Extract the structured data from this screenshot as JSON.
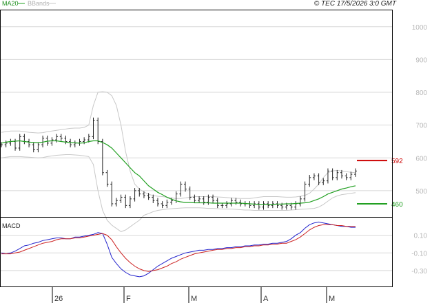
{
  "header": {
    "ma_label": "MA20",
    "bb_label": "BBands",
    "copyright": "© TEC 17/5/2026 3:0 GMT"
  },
  "macd_label": "MACD",
  "colors": {
    "price": "#222222",
    "ma20": "#22a022",
    "bbands": "#c8c8c8",
    "resistance": "#cc0000",
    "support": "#22a022",
    "macd": "#2222cc",
    "signal": "#cc2222",
    "grid": "#d8d8d8"
  },
  "chart_data": [
    {
      "type": "line",
      "panel": "price",
      "ylim": [
        420,
        1050
      ],
      "y_ticks": [
        1000,
        900,
        800,
        700,
        600,
        500
      ],
      "x_ticks": [
        "26",
        "F",
        "M",
        "A",
        "M"
      ],
      "levels": [
        {
          "name": "resistance",
          "value": 592,
          "label": "592"
        },
        {
          "name": "support",
          "value": 460,
          "label": "460"
        }
      ],
      "series": [
        {
          "name": "MA20",
          "values": [
            645,
            648,
            650,
            651,
            652,
            650,
            648,
            647,
            646,
            648,
            651,
            652,
            652,
            650,
            648,
            646,
            646,
            645,
            646,
            650,
            652,
            652,
            647,
            640,
            630,
            615,
            600,
            585,
            570,
            555,
            545,
            530,
            515,
            505,
            495,
            488,
            480,
            474,
            469,
            466,
            464,
            464,
            463,
            463,
            463,
            463,
            462,
            462,
            462,
            462,
            462,
            462,
            462,
            461,
            460,
            459,
            458,
            458,
            458,
            458,
            459,
            459,
            460,
            460,
            461,
            462,
            463,
            465,
            470,
            475,
            482,
            490,
            495,
            500,
            505,
            508,
            512,
            515
          ]
        },
        {
          "name": "BBands upper",
          "values": [
            678,
            680,
            682,
            682,
            682,
            680,
            678,
            677,
            676,
            677,
            680,
            682,
            684,
            686,
            688,
            690,
            691,
            691,
            693,
            700,
            760,
            800,
            802,
            800,
            790,
            760,
            700,
            620,
            560,
            520,
            505,
            496,
            489,
            485,
            483,
            482,
            480,
            478,
            476,
            476,
            478,
            480,
            482,
            482,
            482,
            482,
            482,
            481,
            480,
            479,
            478,
            477,
            476,
            476,
            476,
            478,
            480,
            482,
            482,
            482,
            482,
            481,
            480,
            480,
            481,
            483,
            486,
            492,
            505,
            520,
            540,
            555,
            560,
            562,
            560,
            558,
            556,
            555
          ]
        },
        {
          "name": "BBands lower",
          "values": [
            600,
            602,
            604,
            604,
            604,
            603,
            602,
            601,
            600,
            601,
            604,
            606,
            608,
            609,
            610,
            610,
            609,
            608,
            606,
            604,
            580,
            500,
            440,
            410,
            395,
            385,
            375,
            380,
            390,
            400,
            410,
            425,
            430,
            436,
            440,
            442,
            444,
            445,
            446,
            447,
            448,
            448,
            448,
            448,
            447,
            446,
            446,
            445,
            444,
            444,
            444,
            443,
            442,
            441,
            441,
            440,
            440,
            440,
            440,
            440,
            440,
            440,
            440,
            441,
            442,
            443,
            444,
            445,
            446,
            450,
            458,
            468,
            478,
            484,
            488,
            490,
            492,
            494
          ]
        }
      ],
      "ohlc_closes": [
        640,
        645,
        650,
        630,
        665,
        650,
        640,
        625,
        640,
        660,
        645,
        655,
        665,
        660,
        650,
        640,
        645,
        650,
        655,
        665,
        715,
        650,
        555,
        520,
        460,
        470,
        480,
        455,
        475,
        500,
        490,
        485,
        480,
        470,
        460,
        455,
        465,
        470,
        490,
        520,
        505,
        480,
        470,
        475,
        465,
        480,
        470,
        455,
        455,
        460,
        470,
        465,
        460,
        460,
        455,
        460,
        450,
        460,
        455,
        460,
        455,
        450,
        455,
        450,
        460,
        475,
        520,
        540,
        545,
        525,
        530,
        560,
        540,
        555,
        545,
        540,
        550,
        560
      ]
    },
    {
      "type": "line",
      "panel": "macd",
      "y_ticks": [
        "0.10",
        "-0.10",
        "-0.30"
      ],
      "series": [
        {
          "name": "MACD",
          "values": [
            -0.1,
            -0.11,
            -0.1,
            -0.08,
            -0.05,
            -0.02,
            -0.01,
            0.01,
            0.02,
            0.04,
            0.05,
            0.06,
            0.07,
            0.07,
            0.06,
            0.06,
            0.08,
            0.08,
            0.09,
            0.1,
            0.11,
            0.13,
            0.12,
            0.0,
            -0.15,
            -0.22,
            -0.28,
            -0.32,
            -0.35,
            -0.36,
            -0.37,
            -0.36,
            -0.33,
            -0.29,
            -0.25,
            -0.22,
            -0.19,
            -0.16,
            -0.14,
            -0.12,
            -0.1,
            -0.09,
            -0.08,
            -0.07,
            -0.07,
            -0.06,
            -0.06,
            -0.05,
            -0.05,
            -0.04,
            -0.04,
            -0.03,
            -0.03,
            -0.02,
            -0.02,
            -0.01,
            -0.01,
            0.0,
            0.0,
            0.01,
            0.01,
            0.02,
            0.03,
            0.06,
            0.1,
            0.13,
            0.18,
            0.22,
            0.24,
            0.25,
            0.24,
            0.23,
            0.22,
            0.21,
            0.2,
            0.2,
            0.19,
            0.19
          ]
        },
        {
          "name": "Signal",
          "values": [
            -0.11,
            -0.11,
            -0.11,
            -0.1,
            -0.09,
            -0.07,
            -0.05,
            -0.03,
            -0.01,
            0.01,
            0.02,
            0.03,
            0.05,
            0.06,
            0.06,
            0.06,
            0.07,
            0.07,
            0.08,
            0.09,
            0.1,
            0.11,
            0.12,
            0.1,
            0.05,
            -0.03,
            -0.1,
            -0.16,
            -0.21,
            -0.25,
            -0.28,
            -0.3,
            -0.31,
            -0.3,
            -0.29,
            -0.27,
            -0.25,
            -0.22,
            -0.2,
            -0.17,
            -0.15,
            -0.13,
            -0.11,
            -0.1,
            -0.09,
            -0.08,
            -0.07,
            -0.06,
            -0.06,
            -0.05,
            -0.05,
            -0.04,
            -0.04,
            -0.03,
            -0.03,
            -0.02,
            -0.02,
            -0.01,
            -0.01,
            0.0,
            0.0,
            0.01,
            0.01,
            0.03,
            0.05,
            0.08,
            0.12,
            0.16,
            0.19,
            0.21,
            0.22,
            0.22,
            0.22,
            0.21,
            0.21,
            0.2,
            0.2,
            0.2
          ]
        }
      ]
    }
  ]
}
